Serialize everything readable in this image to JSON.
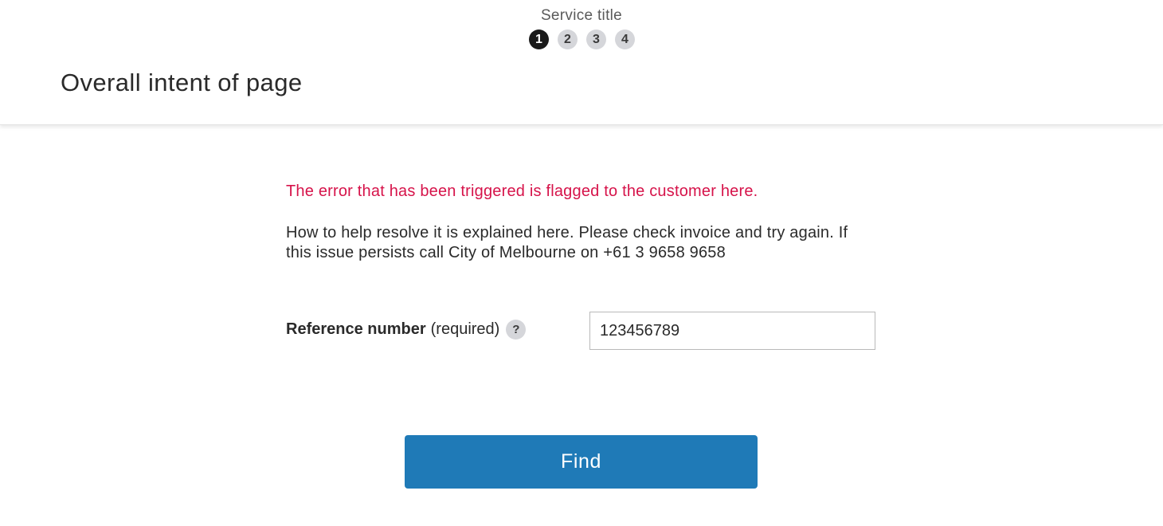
{
  "header": {
    "service_title": "Service title",
    "steps": [
      {
        "label": "1",
        "active": true
      },
      {
        "label": "2",
        "active": false
      },
      {
        "label": "3",
        "active": false
      },
      {
        "label": "4",
        "active": false
      }
    ],
    "page_title": "Overall intent of page"
  },
  "main": {
    "error_message": "The error that has been triggered is flagged to the customer here.",
    "help_message": "How to help resolve it is explained here. Please check invoice and try again. If this issue persists call City of Melbourne on +61 3 9658 9658",
    "field": {
      "label": "Reference number",
      "required_text": "(required)",
      "help_icon": "?",
      "value": "123456789"
    },
    "find_button": "Find"
  },
  "colors": {
    "error": "#d6134a",
    "primary_button": "#1f7ab7",
    "active_step": "#1a1a1a",
    "inactive_step": "#d5d6da"
  }
}
